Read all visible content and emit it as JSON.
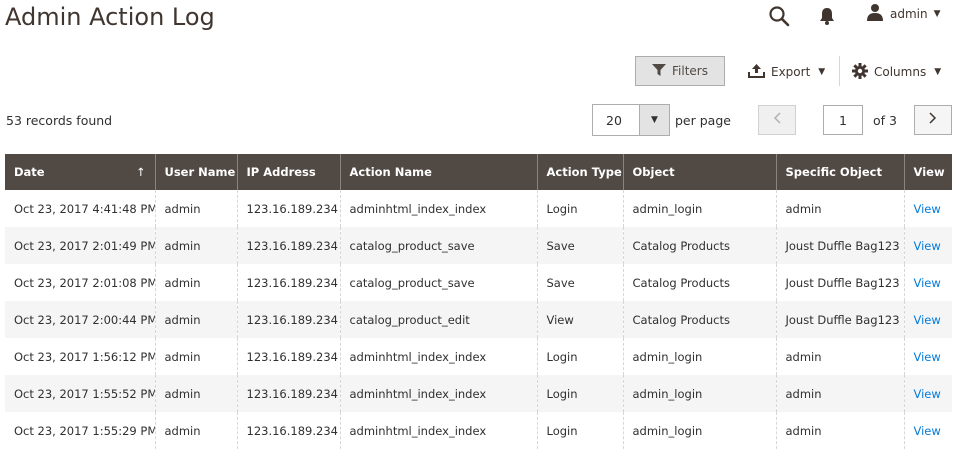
{
  "header": {
    "title": "Admin Action Log",
    "user": "admin"
  },
  "toolbar": {
    "filters_label": "Filters",
    "export_label": "Export",
    "columns_label": "Columns"
  },
  "records_found": "53 records found",
  "pagination": {
    "per_page_value": "20",
    "per_page_label": "per page",
    "current_page": "1",
    "of_label": "of 3"
  },
  "table": {
    "columns": [
      "Date",
      "User Name",
      "IP Address",
      "Action Name",
      "Action Type",
      "Object",
      "Specific Object",
      "View"
    ],
    "sort_indicator": "↑",
    "rows": [
      [
        "Oct 23, 2017 4:41:48 PM",
        "admin",
        "123.16.189.234",
        "adminhtml_index_index",
        "Login",
        "admin_login",
        "admin",
        "View"
      ],
      [
        "Oct 23, 2017 2:01:49 PM",
        "admin",
        "123.16.189.234",
        "catalog_product_save",
        "Save",
        "Catalog Products",
        "Joust Duffle Bag123",
        "View"
      ],
      [
        "Oct 23, 2017 2:01:08 PM",
        "admin",
        "123.16.189.234",
        "catalog_product_save",
        "Save",
        "Catalog Products",
        "Joust Duffle Bag123",
        "View"
      ],
      [
        "Oct 23, 2017 2:00:44 PM",
        "admin",
        "123.16.189.234",
        "catalog_product_edit",
        "View",
        "Catalog Products",
        "Joust Duffle Bag123",
        "View"
      ],
      [
        "Oct 23, 2017 1:56:12 PM",
        "admin",
        "123.16.189.234",
        "adminhtml_index_index",
        "Login",
        "admin_login",
        "admin",
        "View"
      ],
      [
        "Oct 23, 2017 1:55:52 PM",
        "admin",
        "123.16.189.234",
        "adminhtml_index_index",
        "Login",
        "admin_login",
        "admin",
        "View"
      ],
      [
        "Oct 23, 2017 1:55:29 PM",
        "admin",
        "123.16.189.234",
        "adminhtml_index_index",
        "Login",
        "admin_login",
        "admin",
        "View"
      ]
    ]
  },
  "colors": {
    "header_bg": "#514943",
    "link": "#007bdb",
    "row_alt": "#f5f5f5"
  },
  "icons": {
    "search": "search-icon",
    "bell": "bell-icon",
    "user": "user-icon",
    "filter": "filter-icon",
    "export": "export-icon",
    "gear": "gear-icon"
  }
}
